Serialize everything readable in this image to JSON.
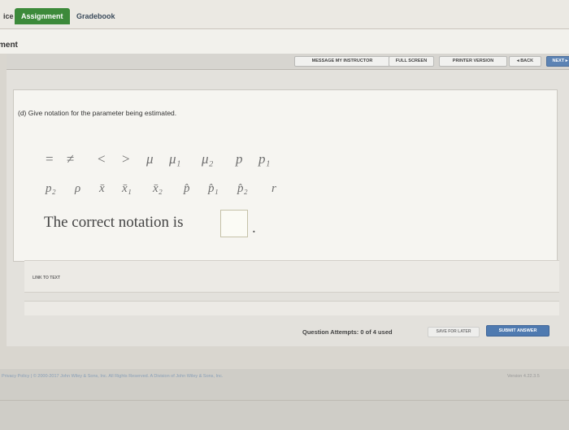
{
  "tabs": [
    {
      "label": "ice"
    },
    {
      "label": "Assignment"
    },
    {
      "label": "Gradebook"
    }
  ],
  "page_heading": "ment",
  "toolbar": {
    "message_instructor": "MESSAGE MY INSTRUCTOR",
    "full_screen": "FULL SCREEN",
    "printer_version": "PRINTER VERSION",
    "back": "◂ BACK",
    "next": "NEXT ▸"
  },
  "question": {
    "prompt": "(d) Give notation for the parameter being estimated.",
    "symbols_row1": [
      "=",
      "≠",
      "<",
      ">",
      "μ",
      "μ₁",
      "μ₂",
      "p",
      "p₁"
    ],
    "symbols_row2": [
      "p₂",
      "ρ",
      "x̄",
      "x̄₁",
      "x̄₂",
      "p̂",
      "p̂₁",
      "p̂₂",
      "r"
    ],
    "answer_label": "The correct notation is",
    "answer_value": "",
    "answer_suffix": "."
  },
  "link_to_text": "LINK TO TEXT",
  "attempts": "Question Attempts: 0 of 4 used",
  "save_for_later": "SAVE FOR LATER",
  "submit_answer": "SUBMIT ANSWER",
  "footer": {
    "links": "Privacy Policy  |  © 2000-2017 John Wiley & Sons, Inc. All Rights Reserved. A Division of John Wiley & Sons, Inc.",
    "version": "Version 4.22.3.5"
  }
}
